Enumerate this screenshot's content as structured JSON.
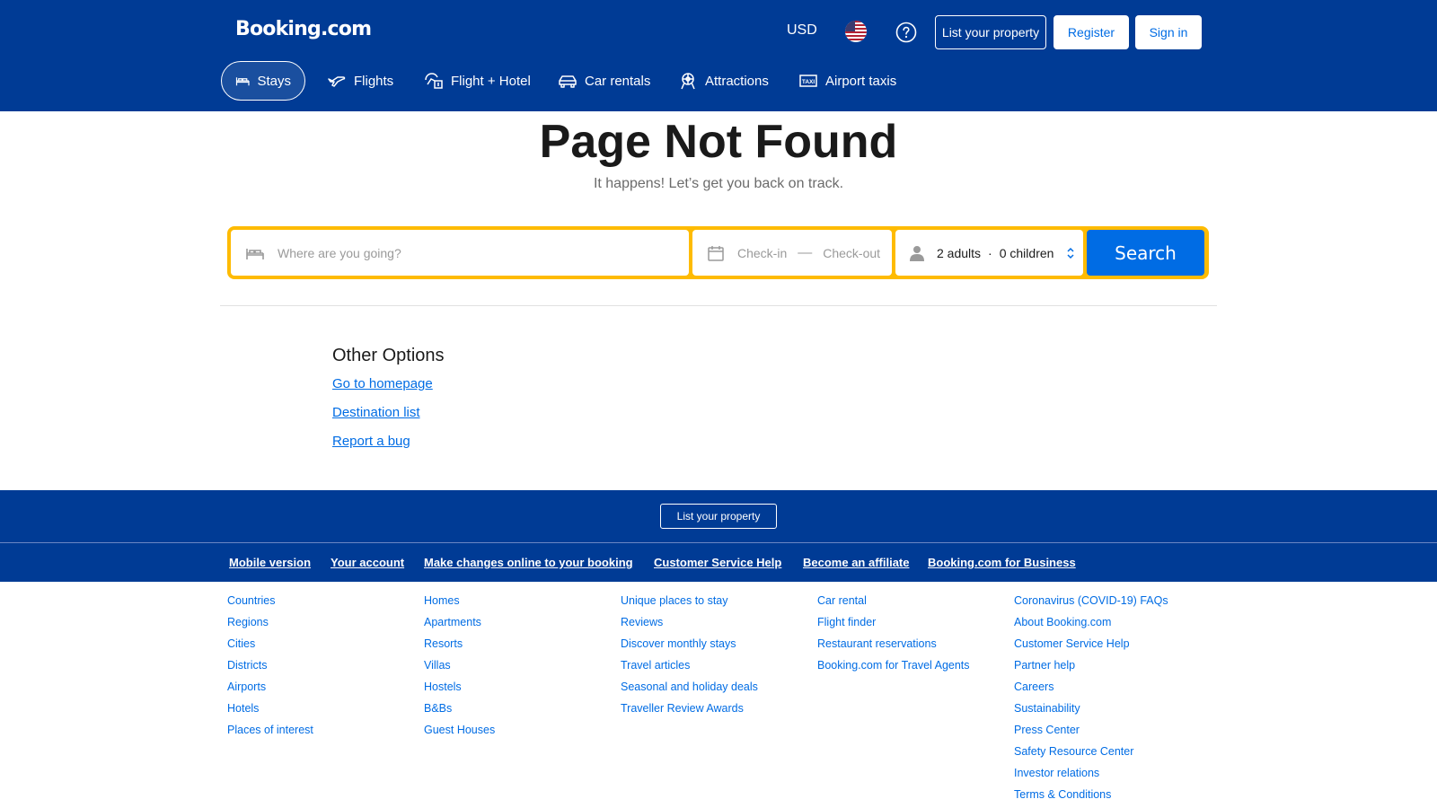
{
  "header": {
    "logo": "Booking.com",
    "currency": "USD",
    "list_property": "List your property",
    "register": "Register",
    "sign_in": "Sign in"
  },
  "nav": {
    "items": [
      {
        "label": "Stays",
        "icon": "bed-icon",
        "active": true
      },
      {
        "label": "Flights",
        "icon": "plane-icon"
      },
      {
        "label": "Flight + Hotel",
        "icon": "flight-hotel-icon"
      },
      {
        "label": "Car rentals",
        "icon": "car-icon"
      },
      {
        "label": "Attractions",
        "icon": "attractions-icon"
      },
      {
        "label": "Airport taxis",
        "icon": "taxi-icon"
      }
    ]
  },
  "main": {
    "title": "Page Not Found",
    "subtitle": "It happens! Let’s get you back on track."
  },
  "search": {
    "destination_placeholder": "Where are you going?",
    "checkin": "Check-in",
    "checkout": "Check-out",
    "adults": "2 adults",
    "children": "0 children",
    "button": "Search"
  },
  "other_options": {
    "title": "Other Options",
    "links": [
      "Go to homepage",
      "Destination list",
      "Report a bug"
    ]
  },
  "footer": {
    "list_property": "List your property",
    "top_links": [
      "Mobile version",
      "Your account",
      "Make changes online to your booking",
      "Customer Service Help",
      "Become an affiliate",
      "Booking.com for Business"
    ],
    "columns": [
      [
        "Countries",
        "Regions",
        "Cities",
        "Districts",
        "Airports",
        "Hotels",
        "Places of interest"
      ],
      [
        "Homes",
        "Apartments",
        "Resorts",
        "Villas",
        "Hostels",
        "B&Bs",
        "Guest Houses"
      ],
      [
        "Unique places to stay",
        "Reviews",
        "Discover monthly stays",
        "Travel articles",
        "Seasonal and holiday deals",
        "Traveller Review Awards"
      ],
      [
        "Car rental",
        "Flight finder",
        "Restaurant reservations",
        "Booking.com for Travel Agents"
      ],
      [
        "Coronavirus (COVID-19) FAQs",
        "About Booking.com",
        "Customer Service Help",
        "Partner help",
        "Careers",
        "Sustainability",
        "Press Center",
        "Safety Resource Center",
        "Investor relations",
        "Terms & Conditions"
      ]
    ]
  },
  "colors": {
    "brand_blue": "#003b95",
    "action_blue": "#006ce4",
    "search_border": "#febb02"
  }
}
